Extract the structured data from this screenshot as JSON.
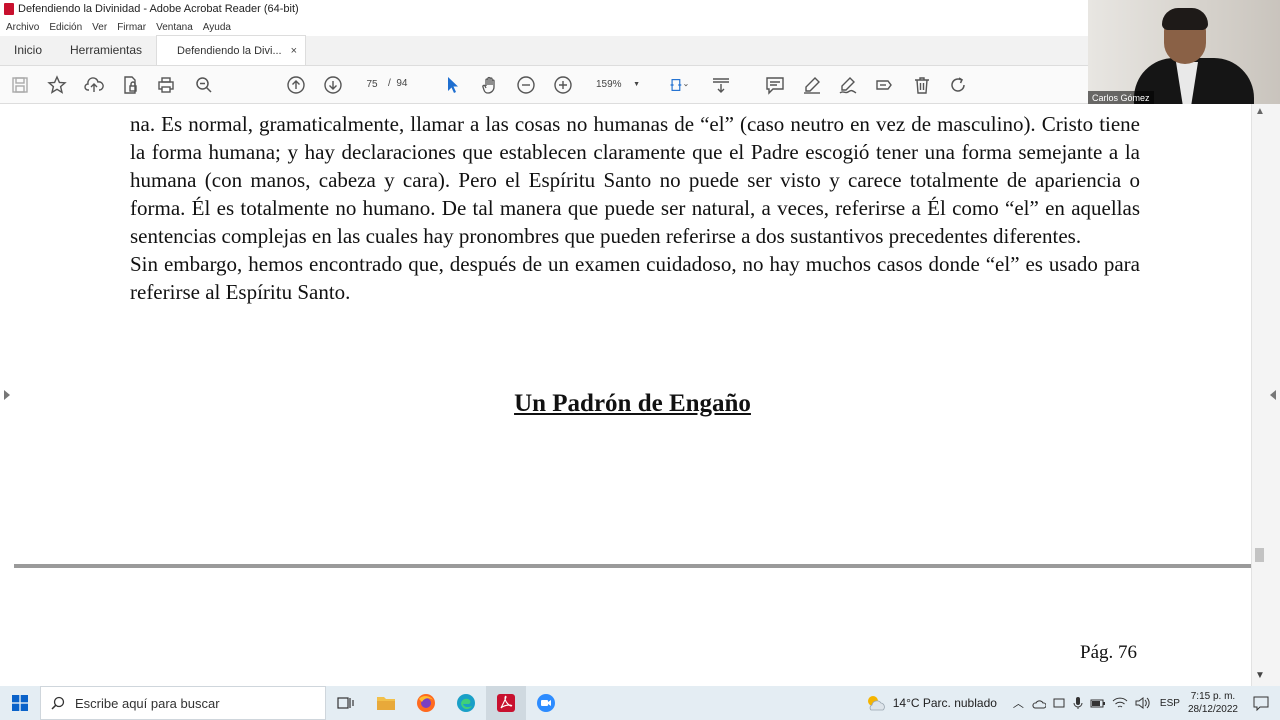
{
  "window": {
    "title": "Defendiendo la Divinidad - Adobe Acrobat Reader (64-bit)"
  },
  "menu": [
    "Archivo",
    "Edición",
    "Ver",
    "Firmar",
    "Ventana",
    "Ayuda"
  ],
  "tabs": {
    "home": "Inicio",
    "tools": "Herramientas",
    "doc": "Defendiendo la Divi...",
    "close": "×"
  },
  "toolbar": {
    "page_current": "75",
    "page_separator": "/",
    "page_total": "94",
    "zoom": "159%"
  },
  "document": {
    "paragraph1": "na. Es normal, gramaticalmente, llamar a las cosas no humanas de “el” (caso neutro en vez de masculino). Cristo tiene la forma humana; y hay declaraciones que establecen claramente que el Padre escogió tener una forma semejante a la humana (con manos, cabeza y cara). Pero el Espíritu Santo no puede ser visto y carece totalmente de apariencia o forma. Él es totalmente no humano. De tal manera que puede ser natural, a veces, referirse a Él como “el” en aquellas sentencias complejas en las cuales hay pronombres que pueden referirse a dos sustantivos precedentes diferentes.",
    "paragraph2": "Sin embargo, hemos encontrado que, después de un examen cuidadoso, no hay muchos casos donde “el” es usado para referirse al Espíritu Santo.",
    "heading": "Un Padrón de Engaño",
    "page_number": "Pág. 76"
  },
  "webcam": {
    "name": "Carlos Gómez"
  },
  "taskbar": {
    "search_placeholder": "Escribe aquí para buscar",
    "weather": "14°C  Parc. nublado",
    "language": "ESP",
    "time": "7:15 p. m.",
    "date": "28/12/2022"
  },
  "colors": {
    "acrobat_red": "#c8102e",
    "toolbar_icon": "#555555",
    "active_tool_blue": "#1f6fd0"
  }
}
